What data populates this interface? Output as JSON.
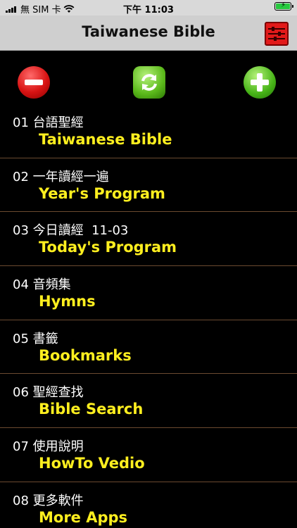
{
  "status_bar": {
    "carrier": "無 SIM 卡",
    "time": "下午 11:03"
  },
  "nav": {
    "title": "Taiwanese Bible"
  },
  "icons": {
    "remove": "minus-circle-icon",
    "refresh": "refresh-icon",
    "add": "plus-circle-icon",
    "settings": "settings-icon"
  },
  "colors": {
    "item_subtitle": "#ffef1f",
    "divider": "#6b4a30"
  },
  "menu": {
    "items": [
      {
        "title": "01 台語聖經",
        "subtitle": "Taiwanese Bible"
      },
      {
        "title": "02 一年讀經一遍",
        "subtitle": "Year's Program"
      },
      {
        "title": "03 今日讀經  11-03",
        "subtitle": "Today's Program"
      },
      {
        "title": "04 音頻集",
        "subtitle": "Hymns"
      },
      {
        "title": "05 書籤",
        "subtitle": "Bookmarks"
      },
      {
        "title": "06 聖經查找",
        "subtitle": "Bible Search"
      },
      {
        "title": "07 使用說明",
        "subtitle": "HowTo Vedio"
      },
      {
        "title": "08 更多軟件",
        "subtitle": "More Apps"
      }
    ]
  }
}
